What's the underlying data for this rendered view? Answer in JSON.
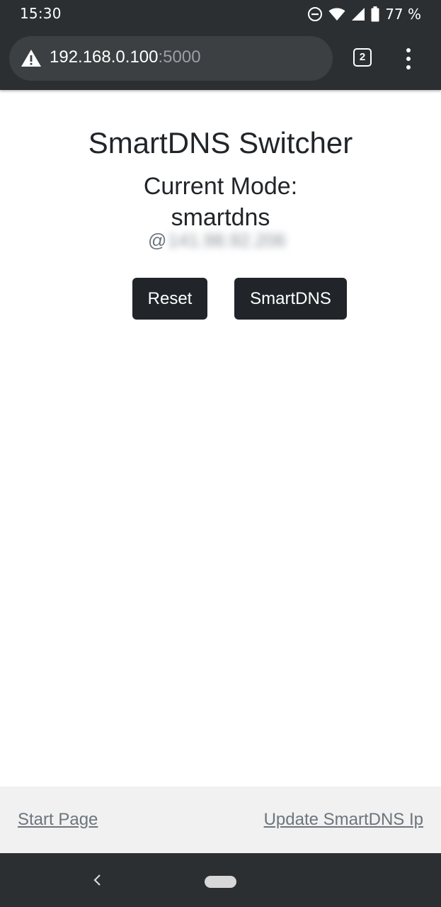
{
  "status_bar": {
    "time": "15:30",
    "battery": "77 %",
    "icons": [
      "do-not-disturb-icon",
      "wifi-icon",
      "signal-icon",
      "battery-icon"
    ]
  },
  "browser": {
    "url_host": "192.168.0.100",
    "url_port": ":5000",
    "tab_count": "2",
    "icons": [
      "not-secure-warning-icon",
      "tabs-icon",
      "more-menu-icon"
    ]
  },
  "page": {
    "title": "SmartDNS Switcher",
    "mode_label": "Current Mode:",
    "mode_value": "smartdns",
    "ip_prefix": "@",
    "ip_value": "141.98.92.206",
    "buttons": {
      "reset": "Reset",
      "smartdns": "SmartDNS"
    }
  },
  "footer": {
    "start_page": "Start Page",
    "update_ip": "Update SmartDNS Ip"
  },
  "colors": {
    "system_bar": "#2b2f32",
    "omnibox": "#3c4043",
    "button_bg": "#212529",
    "footer_bg": "#f1f1f1",
    "link": "#6c757d"
  }
}
